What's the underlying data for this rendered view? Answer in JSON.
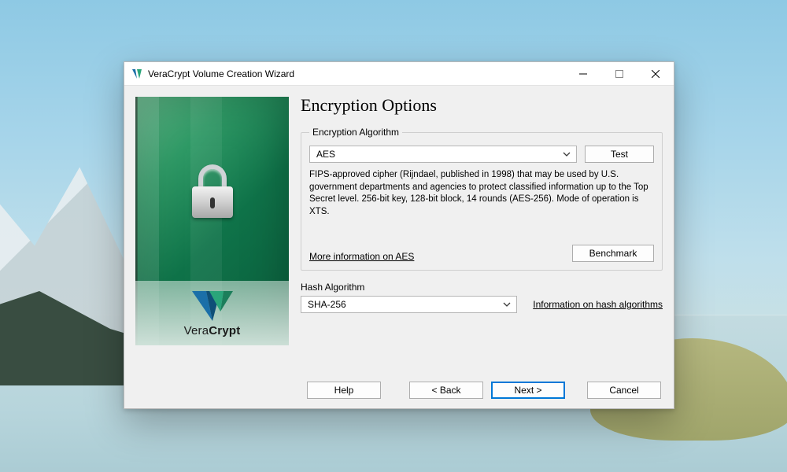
{
  "window": {
    "title": "VeraCrypt Volume Creation Wizard"
  },
  "brand": {
    "name_html_prefix": "Vera",
    "name_html_bold": "Crypt"
  },
  "page": {
    "title": "Encryption Options"
  },
  "encryption": {
    "legend": "Encryption Algorithm",
    "selected": "AES",
    "test_button": "Test",
    "description": "FIPS-approved cipher (Rijndael, published in 1998) that may be used by U.S. government departments and agencies to protect classified information up to the Top Secret level. 256-bit key, 128-bit block, 14 rounds (AES-256). Mode of operation is XTS.",
    "more_link": "More information on AES",
    "benchmark_button": "Benchmark"
  },
  "hash": {
    "label": "Hash Algorithm",
    "selected": "SHA-256",
    "info_link": "Information on hash algorithms"
  },
  "footer": {
    "help": "Help",
    "back": "< Back",
    "next": "Next >",
    "cancel": "Cancel"
  }
}
